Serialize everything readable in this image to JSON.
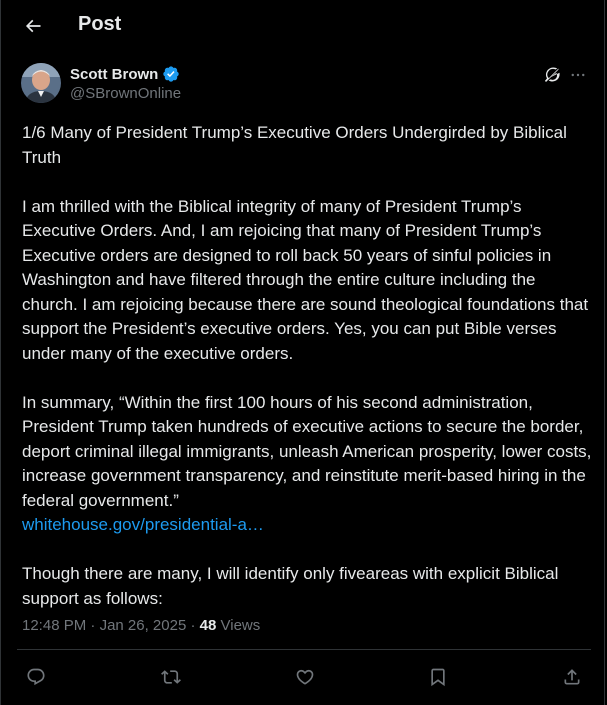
{
  "header": {
    "title": "Post",
    "back_icon": "arrow-left-icon"
  },
  "author": {
    "name": "Scott Brown",
    "handle": "@SBrownOnline",
    "verified": true,
    "verified_color": "#1d9bf0"
  },
  "post": {
    "paragraphs": [
      "1/6 Many of President Trump’s Executive Orders Undergirded by Biblical Truth",
      "I am thrilled with the Biblical integrity of many of President Trump’s Executive Orders. And, I am rejoicing that many of President Trump’s Executive orders are designed to roll back 50 years of sinful policies in Washington and have filtered through the entire culture including the church. I am rejoicing because there are sound theological  foundations that support the President’s executive orders. Yes, you can put Bible verses under many of the executive orders.",
      "In summary, “Within the first 100 hours of his second administration, President Trump taken hundreds of executive actions to secure the border, deport criminal illegal immigrants, unleash American prosperity, lower costs, increase government transparency, and reinstitute merit-based hiring in the federal government.”"
    ],
    "link_text": "whitehouse.gov/presidential-a…",
    "final_paragraph": "Though there are many, I will identify only fiveareas with explicit Biblical support as follows:"
  },
  "meta": {
    "time": "12:48 PM",
    "separator": " · ",
    "date": "Jan 26, 2025",
    "views_separator": " · ",
    "views_count": "48",
    "views_label": " Views"
  },
  "actions": [
    {
      "name": "reply-icon"
    },
    {
      "name": "retweet-icon"
    },
    {
      "name": "like-icon"
    },
    {
      "name": "bookmark-icon"
    },
    {
      "name": "share-icon"
    }
  ],
  "colors": {
    "background": "#000000",
    "text": "#e7e9ea",
    "secondary": "#71767b",
    "link": "#1d9bf0",
    "border": "#2f3336"
  }
}
